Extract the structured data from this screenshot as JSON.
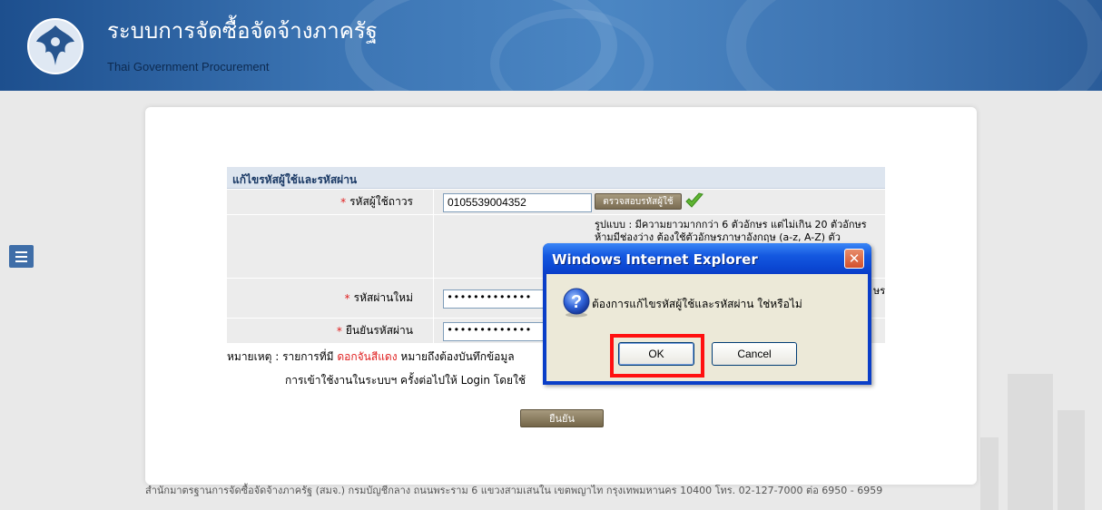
{
  "header": {
    "title": "ระบบการจัดซื้อจัดจ้างภาครัฐ",
    "subtitle": "Thai Government Procurement"
  },
  "form": {
    "heading": "แก้ไขรหัสผู้ใช้และรหัสผ่าน",
    "username": {
      "required_mark": "*",
      "label": "รหัสผู้ใช้ถาวร",
      "value": "0105539004352",
      "check_button": "ตรวจสอบรหัสผู้ใช้"
    },
    "format_hint": {
      "line1": "รูปแบบ : มีความยาวมากกว่า 6 ตัวอักษร แต่ไม่เกิน 20 ตัวอักษร",
      "line2": "ห้ามมีช่องว่าง ต้องใช้ตัวอักษรภาษาอังกฤษ (a-z, A-Z) ตัว",
      "tail": "ษร"
    },
    "new_password": {
      "required_mark": "*",
      "label": "รหัสผ่านใหม่",
      "value": "•••••••••••••"
    },
    "confirm_password": {
      "required_mark": "*",
      "label": "ยืนยันรหัสผ่าน",
      "value": "•••••••••••••"
    }
  },
  "note": {
    "prefix": "หมายเหตุ : รายการที่มี ",
    "red_text": "ดอกจันสีแดง",
    "suffix": " หมายถึงต้องบันทึกข้อมูล",
    "line2": "การเข้าใช้งานในระบบฯ ครั้งต่อไปให้ Login โดยใช้"
  },
  "confirm_button": "ยืนยัน",
  "footer": "สำนักมาตรฐานการจัดซื้อจัดจ้างภาครัฐ (สมจ.) กรมบัญชีกลาง ถนนพระราม 6 แขวงสามเสนใน เขตพญาไท กรุงเทพมหานคร 10400 โทร. 02-127-7000 ต่อ 6950 - 6959",
  "dialog": {
    "title": "Windows Internet Explorer",
    "message": "ต้องการแก้ไขรหัสผู้ใช้และรหัสผ่าน ใช่หรือไม่",
    "ok_label": "OK",
    "cancel_label": "Cancel",
    "close_glyph": "✕",
    "icon": "question-icon"
  },
  "colors": {
    "required": "#e02020",
    "highlight": "#ff1010",
    "dialog_title": "#0a3ec8"
  }
}
